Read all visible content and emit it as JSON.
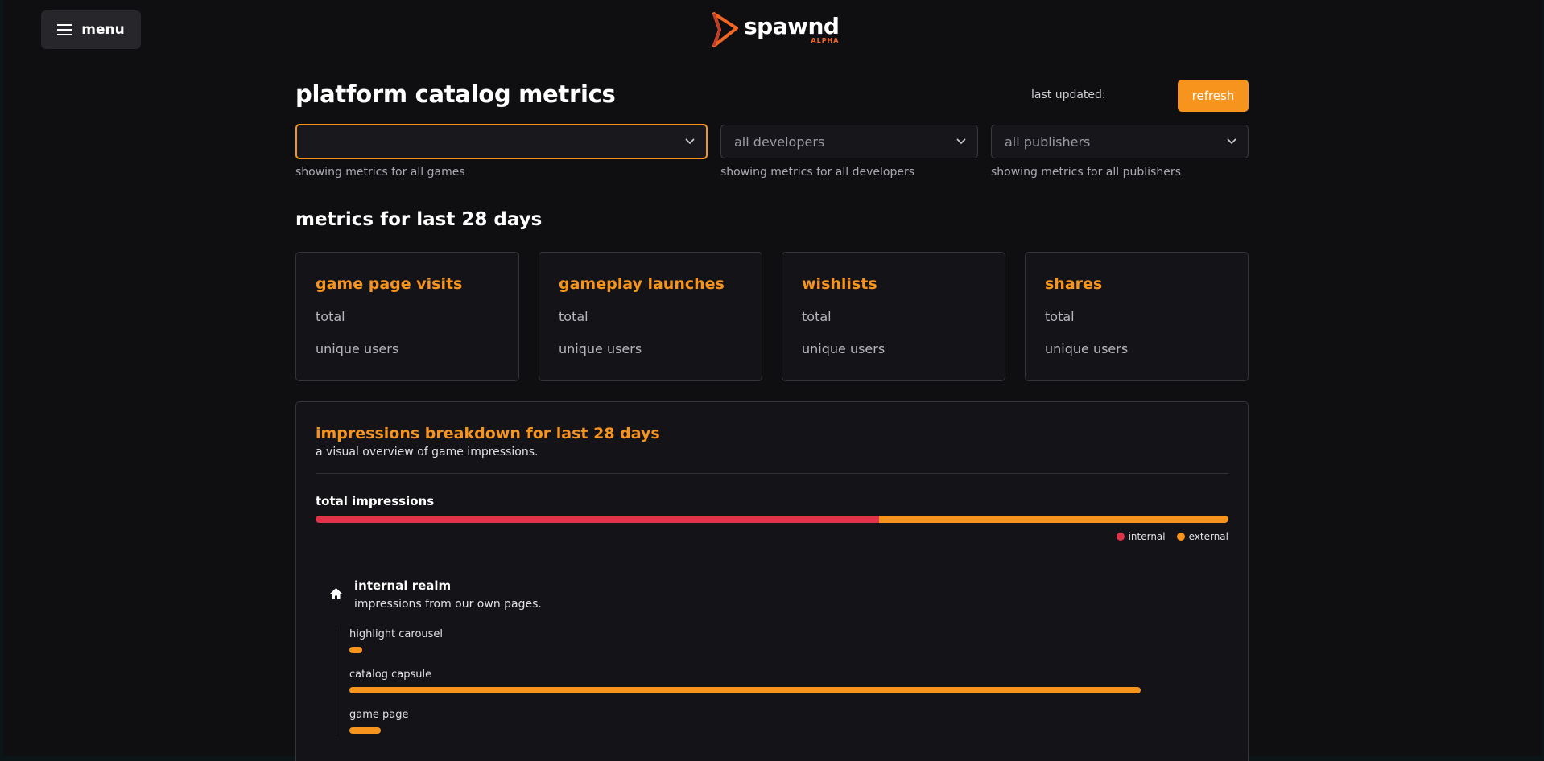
{
  "header": {
    "menu_label": "menu",
    "logo_text": "spawnd",
    "logo_sub": "ALPHA"
  },
  "page": {
    "title": "platform catalog metrics",
    "last_updated_label": "last updated:",
    "refresh_label": "refresh"
  },
  "filters": {
    "games": {
      "value": "",
      "hint": "showing metrics for all games"
    },
    "developers": {
      "value": "all developers",
      "hint": "showing metrics for all developers"
    },
    "publishers": {
      "value": "all publishers",
      "hint": "showing metrics for all publishers"
    }
  },
  "metrics": {
    "section_title": "metrics for last 28 days",
    "cards": [
      {
        "title": "game page visits",
        "line1": "total",
        "line2": "unique users"
      },
      {
        "title": "gameplay launches",
        "line1": "total",
        "line2": "unique users"
      },
      {
        "title": "wishlists",
        "line1": "total",
        "line2": "unique users"
      },
      {
        "title": "shares",
        "line1": "total",
        "line2": "unique users"
      }
    ]
  },
  "impressions": {
    "title": "impressions breakdown for last 28 days",
    "subtitle": "a visual overview of game impressions.",
    "total_label": "total impressions",
    "internal_fraction": 0.617,
    "legend": {
      "internal": "internal",
      "external": "external"
    },
    "internal_realm": {
      "title": "internal realm",
      "subtitle": "impressions from our own pages.",
      "sources": [
        {
          "label": "highlight carousel",
          "fraction": 0.015
        },
        {
          "label": "catalog capsule",
          "fraction": 0.9
        },
        {
          "label": "game page",
          "fraction": 0.036
        }
      ]
    }
  },
  "colors": {
    "accent": "#f7941d",
    "internal": "#e0334a",
    "external": "#f7941d",
    "background": "#0f0f12",
    "card": "#141418"
  },
  "icons": {
    "menu": "hamburger-icon",
    "logo": "spawnd-logo-icon",
    "chevron": "chevron-down-icon",
    "realm": "home-icon"
  }
}
